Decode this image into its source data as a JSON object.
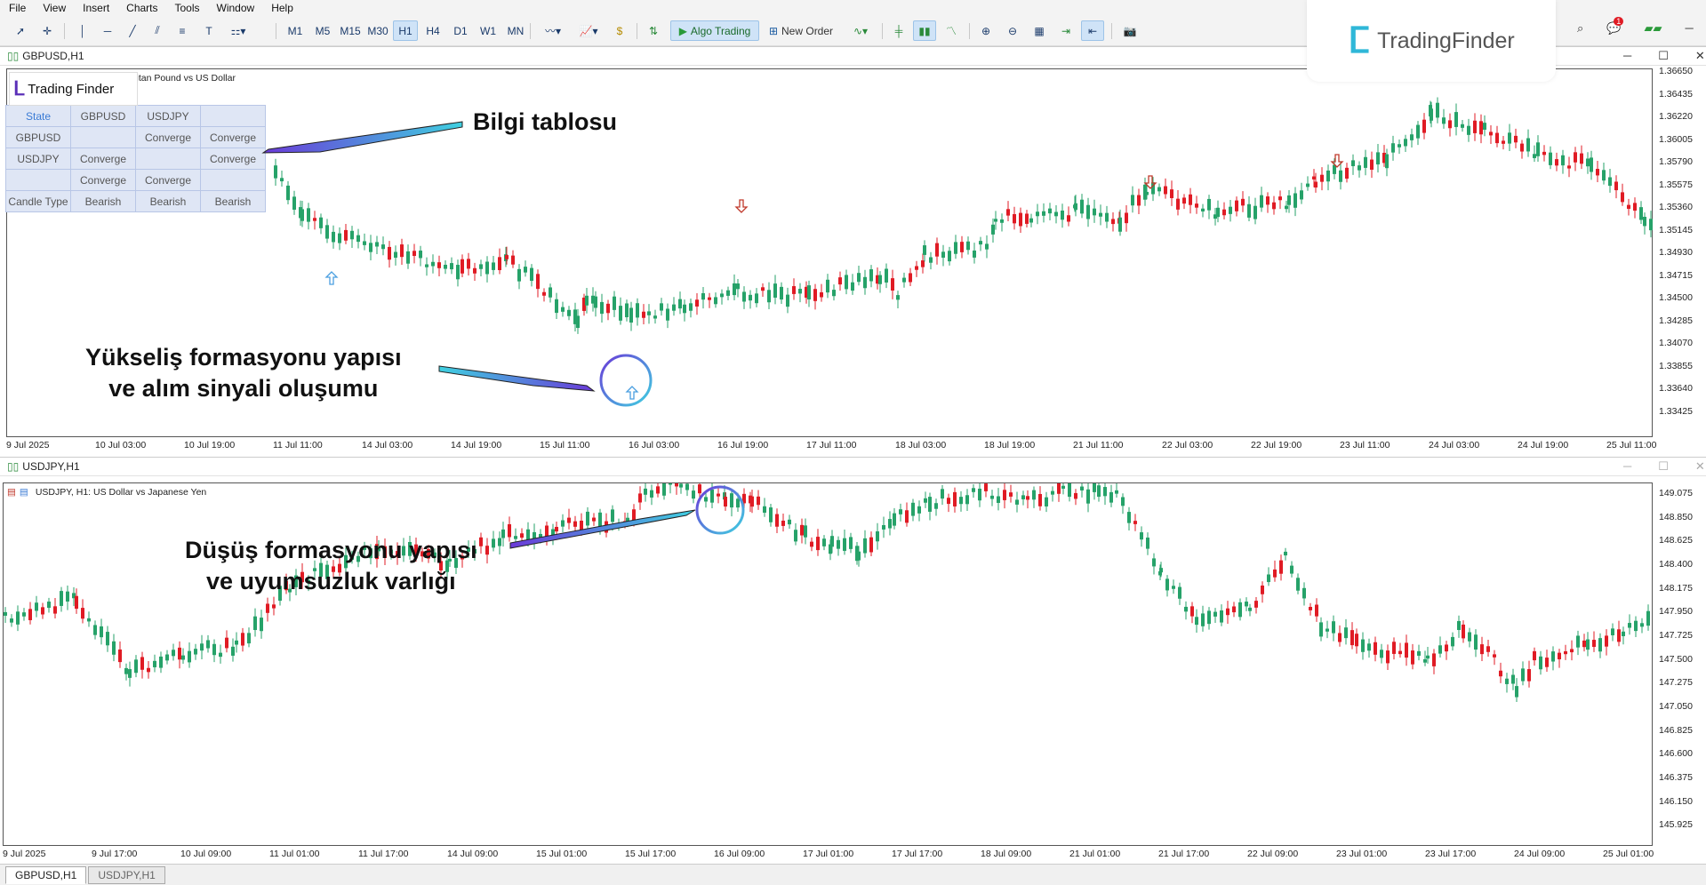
{
  "menu": [
    "File",
    "View",
    "Insert",
    "Charts",
    "Tools",
    "Window",
    "Help"
  ],
  "toolbar": {
    "timeframes": [
      "M1",
      "M5",
      "M15",
      "M30",
      "H1",
      "H4",
      "D1",
      "W1",
      "MN"
    ],
    "active_timeframe": "H1",
    "algo_trading_label": "Algo Trading",
    "new_order_label": "New Order",
    "notification_count": "1"
  },
  "brand": {
    "name": "TradingFinder"
  },
  "chart1": {
    "title": "GBPUSD,H1",
    "subtitle": "ritan Pound vs US Dollar",
    "logo_text": "Trading Finder",
    "price_labels": [
      "1.36650",
      "1.36435",
      "1.36220",
      "1.36005",
      "1.35790",
      "1.35575",
      "1.35360",
      "1.35145",
      "1.34930",
      "1.34715",
      "1.34500",
      "1.34285",
      "1.34070",
      "1.33855",
      "1.33640",
      "1.33425"
    ],
    "time_labels": [
      "9 Jul 2025",
      "10 Jul 03:00",
      "10 Jul 19:00",
      "11 Jul 11:00",
      "14 Jul 03:00",
      "14 Jul 19:00",
      "15 Jul 11:00",
      "16 Jul 03:00",
      "16 Jul 19:00",
      "17 Jul 11:00",
      "18 Jul 03:00",
      "18 Jul 19:00",
      "21 Jul 11:00",
      "22 Jul 03:00",
      "22 Jul 19:00",
      "23 Jul 11:00",
      "24 Jul 03:00",
      "24 Jul 19:00",
      "25 Jul 11:00"
    ],
    "table": [
      [
        "State",
        "GBPUSD",
        "USDJPY",
        ""
      ],
      [
        "GBPUSD",
        "",
        "Converge",
        "Converge"
      ],
      [
        "USDJPY",
        "Converge",
        "",
        "Converge"
      ],
      [
        "",
        "Converge",
        "Converge",
        ""
      ],
      [
        "Candle Type",
        "Bearish",
        "Bearish",
        "Bearish"
      ]
    ],
    "annotation_table": "Bilgi tablosu",
    "annotation_bullish": "Yükseliş formasyonu yapısı\nve alım sinyali oluşumu"
  },
  "chart2": {
    "title": "USDJPY,H1",
    "subtitle": "USDJPY, H1:  US Dollar vs Japanese Yen",
    "price_labels": [
      "149.075",
      "148.850",
      "148.625",
      "148.400",
      "148.175",
      "147.950",
      "147.725",
      "147.500",
      "147.275",
      "147.050",
      "146.825",
      "146.600",
      "146.375",
      "146.150",
      "145.925"
    ],
    "time_labels": [
      "9 Jul 2025",
      "9 Jul 17:00",
      "10 Jul 09:00",
      "11 Jul 01:00",
      "11 Jul 17:00",
      "14 Jul 09:00",
      "15 Jul 01:00",
      "15 Jul 17:00",
      "16 Jul 09:00",
      "17 Jul 01:00",
      "17 Jul 17:00",
      "18 Jul 09:00",
      "21 Jul 01:00",
      "21 Jul 17:00",
      "22 Jul 09:00",
      "23 Jul 01:00",
      "23 Jul 17:00",
      "24 Jul 09:00",
      "25 Jul 01:00"
    ],
    "annotation_bearish": "Düşüş formasyonu yapısı\nve uyumsuzluk varlığı"
  },
  "bottom_tabs": [
    "GBPUSD,H1",
    "USDJPY,H1"
  ],
  "active_tab": "GBPUSD,H1",
  "colors": {
    "bull": "#26a269",
    "bear": "#e01b24",
    "accent": "#3a7bd5",
    "arrow_up": "#4a9fe0",
    "arrow_down": "#c0392b"
  }
}
